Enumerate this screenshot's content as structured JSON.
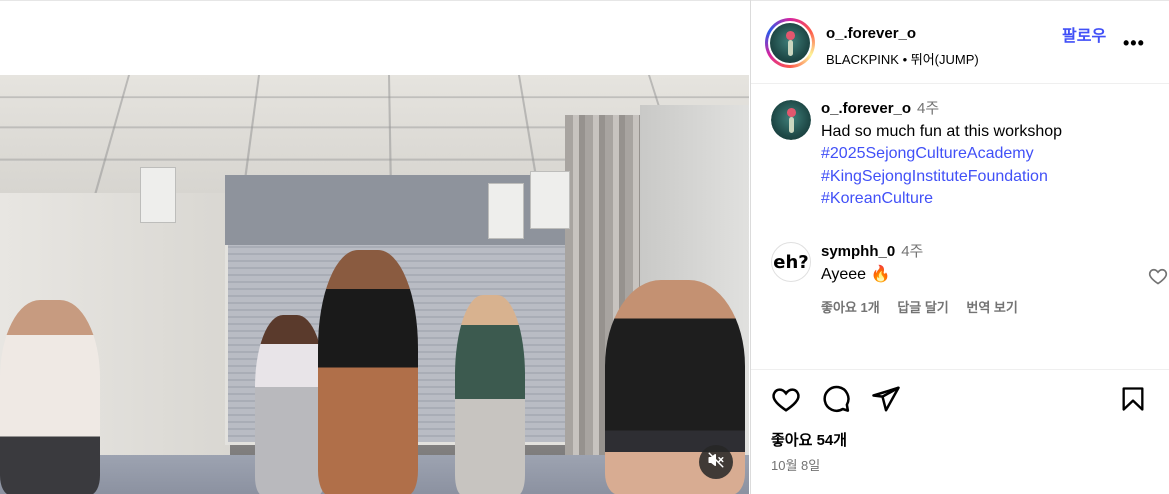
{
  "post": {
    "author": "o_.forever_o",
    "audio": "BLACKPINK • 뛰어(JUMP)",
    "follow_label": "팔로우",
    "more_label": "•••"
  },
  "caption": {
    "username": "o_.forever_o",
    "time": "4주",
    "text": "Had so much fun at this workshop",
    "hashtags": [
      "#2025SejongCultureAcademy",
      "#KingSejongInstituteFoundation",
      "#KoreanCulture"
    ]
  },
  "comment": {
    "avatar_text": "eh?",
    "username": "symphh_0",
    "time": "4주",
    "text": "Ayeee 🔥",
    "likes_label": "좋아요 1개",
    "reply_label": "답글 달기",
    "translate_label": "번역 보기"
  },
  "footer": {
    "likes": "좋아요 54개",
    "date": "10월 8일"
  },
  "icons": {
    "like": "heart-icon",
    "comment": "comment-icon",
    "share": "send-icon",
    "save": "bookmark-icon",
    "mute": "speaker-muted-icon"
  },
  "colors": {
    "link": "#4150f7",
    "muted": "#737373"
  }
}
